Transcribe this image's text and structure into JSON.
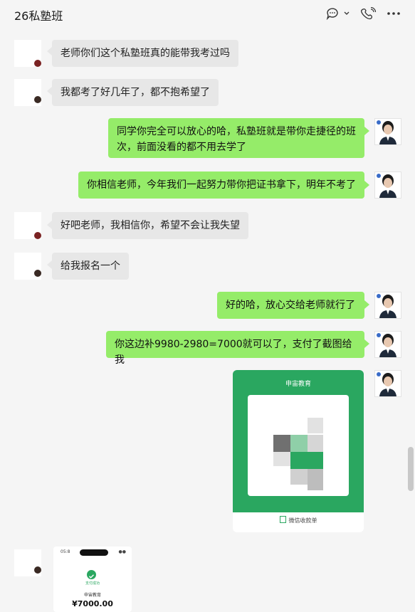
{
  "header": {
    "title": "26私塾班",
    "icons": [
      "chat-menu-icon",
      "phone-icon",
      "more-icon"
    ]
  },
  "messages": [
    {
      "side": "in",
      "text": "老师你们这个私塾班真的能带我考过吗"
    },
    {
      "side": "in",
      "text": "我都考了好几年了，都不抱希望了"
    },
    {
      "side": "out",
      "text": "同学你完全可以放心的哈，私塾班就是带你走捷径的班次，前面没看的都不用去学了"
    },
    {
      "side": "out",
      "text": "你相信老师，今年我们一起努力带你把证书拿下，明年不考了"
    },
    {
      "side": "in",
      "text": "好吧老师，我相信你，希望不会让我失望"
    },
    {
      "side": "in",
      "text": "给我报名一个"
    },
    {
      "side": "out",
      "text": "好的哈，放心交给老师就行了"
    },
    {
      "side": "out",
      "text": "你这边补9980-2980=7000就可以了，支付了截图给我"
    }
  ],
  "qr_card": {
    "merchant": "申宙教育",
    "footer": "微信收款单"
  },
  "payment_card": {
    "status_left": "05:8",
    "status_right": "●●",
    "success_label": "支付成功",
    "merchant": "申宙教育",
    "amount": "¥7000.00"
  },
  "colors": {
    "outgoing_bubble": "#95ec69",
    "incoming_bubble": "#e7e7e7",
    "qr_green": "#2aa760",
    "background": "#f5f5f5"
  }
}
